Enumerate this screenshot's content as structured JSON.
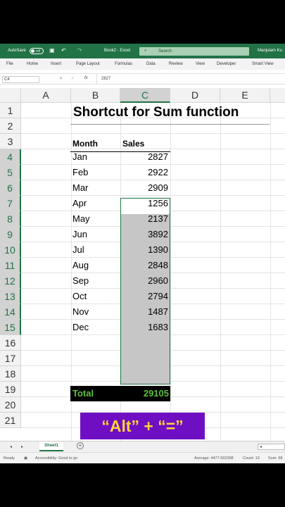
{
  "titlebar": {
    "autosave": "AutoSave",
    "toggle": "Off",
    "doc_title": "Book2 - Excel",
    "search_placeholder": "Search",
    "user": "Manjulam Ku"
  },
  "menu": [
    "File",
    "Home",
    "Insert",
    "Page Layout",
    "Formulas",
    "Data",
    "Review",
    "View",
    "Developer",
    "Smart View"
  ],
  "formula_bar": {
    "name_box": "C4",
    "fx": "fx",
    "value": "2827"
  },
  "columns": [
    "A",
    "B",
    "C",
    "D",
    "E"
  ],
  "rows": [
    "1",
    "2",
    "3",
    "4",
    "5",
    "6",
    "7",
    "8",
    "9",
    "10",
    "11",
    "12",
    "13",
    "14",
    "15",
    "16",
    "17",
    "18",
    "19",
    "20",
    "21"
  ],
  "sheet": {
    "title": "Shortcut for Sum function",
    "header_month": "Month",
    "header_sales": "Sales",
    "data": [
      {
        "month": "Jan",
        "sales": "2827"
      },
      {
        "month": "Feb",
        "sales": "2922"
      },
      {
        "month": "Mar",
        "sales": "2909"
      },
      {
        "month": "Apr",
        "sales": "1256"
      },
      {
        "month": "May",
        "sales": "2137"
      },
      {
        "month": "Jun",
        "sales": "3892"
      },
      {
        "month": "Jul",
        "sales": "1390"
      },
      {
        "month": "Aug",
        "sales": "2848"
      },
      {
        "month": "Sep",
        "sales": "2960"
      },
      {
        "month": "Oct",
        "sales": "2794"
      },
      {
        "month": "Nov",
        "sales": "1487"
      },
      {
        "month": "Dec",
        "sales": "1683"
      }
    ],
    "total_label": "Total",
    "total_value": "29105"
  },
  "shortcut_banner": "“Alt” + “=”",
  "tabs": {
    "sheet1": "Sheet1",
    "add": "+"
  },
  "status": {
    "ready": "Ready",
    "accessibility": "Accessibility: Good to go",
    "average": "Average: 4477.692308",
    "count": "Count: 13",
    "sum": "Sum: 58"
  }
}
